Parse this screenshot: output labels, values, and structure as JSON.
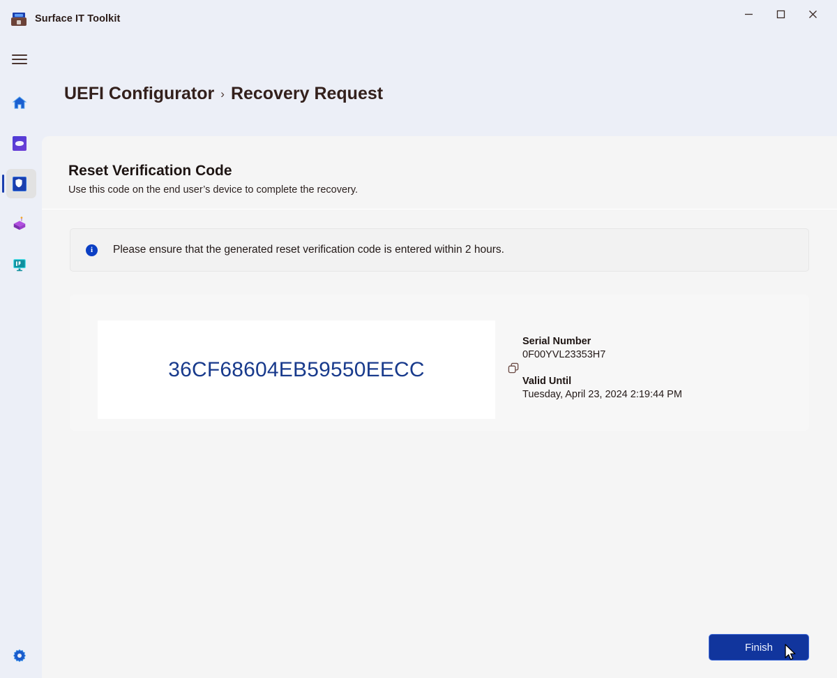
{
  "window": {
    "app_icon": "toolkit-icon",
    "title": "Surface IT Toolkit",
    "controls": [
      {
        "name": "minimize",
        "glyph": "minimize-icon"
      },
      {
        "name": "maximize",
        "glyph": "maximize-icon"
      },
      {
        "name": "close",
        "glyph": "close-icon"
      }
    ]
  },
  "rail": {
    "menu_icon": "hamburger-menu-icon",
    "items": [
      {
        "icon": "home-icon",
        "selected": false
      },
      {
        "icon": "data-eraser-icon",
        "selected": false
      },
      {
        "icon": "uefi-shield-icon",
        "selected": true
      },
      {
        "icon": "package-icon",
        "selected": false
      },
      {
        "icon": "monitor-diagnostics-icon",
        "selected": false
      }
    ],
    "settings_icon": "gear-icon"
  },
  "breadcrumb": {
    "first": "UEFI Configurator",
    "separator": "›",
    "last": "Recovery Request"
  },
  "section": {
    "title": "Reset Verification Code",
    "subtitle": "Use this code on the end user’s device to complete the recovery."
  },
  "info": {
    "icon": "info-icon",
    "glyph": "i",
    "text": "Please ensure that the generated reset verification code is entered within 2 hours."
  },
  "code_card": {
    "code": "36CF68604EB59550EECC",
    "copy_icon": "copy-icon",
    "serial_label": "Serial Number",
    "serial_value": "0F00YVL23353H7",
    "valid_label": "Valid Until",
    "valid_value": "Tuesday, April 23, 2024 2:19:44 PM"
  },
  "footer": {
    "finish_label": "Finish"
  },
  "colors": {
    "accent_blue": "#11359d",
    "code_blue": "#183a8c",
    "info_blue": "#0b3fc4",
    "app_bg": "#eceff7",
    "card_bg": "#f5f5f5"
  }
}
